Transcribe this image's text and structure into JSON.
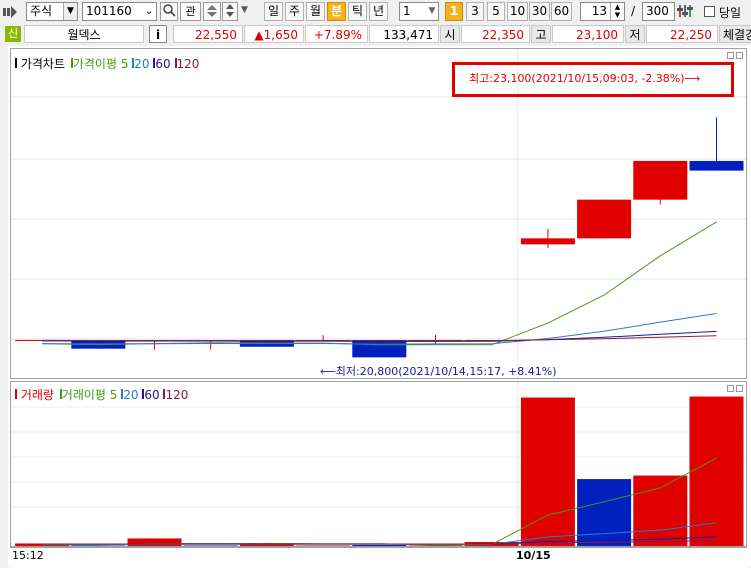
{
  "toolbar": {
    "market": "주식",
    "code": "101160",
    "btn_interest": "관",
    "periods": [
      "일",
      "주",
      "월",
      "분",
      "틱",
      "년"
    ],
    "active_period": "분",
    "unit_value": "1",
    "intervals": [
      "1",
      "3",
      "5",
      "10",
      "30",
      "60"
    ],
    "active_interval": "1",
    "count_value": "13",
    "slash": "/",
    "total_value": "300",
    "today_label": "당일"
  },
  "quote": {
    "badge": "신",
    "name": "월덱스",
    "info": "i",
    "price": "22,550",
    "change": "▲1,650",
    "change_pct": "+7.89%",
    "volume": "133,471",
    "open_label": "시",
    "open": "22,350",
    "high_label": "고",
    "high": "23,100",
    "low_label": "저",
    "low": "22,250",
    "exec_label": "체결강"
  },
  "price_panel": {
    "legend": {
      "main": "가격차트",
      "ma_label": "가격이평",
      "ma": [
        "5",
        "20",
        "60",
        "120"
      ]
    },
    "high_annotation": "최고:23,100(2021/10/15,09:03, -2.38%)⟶",
    "low_annotation": "⟵최저:20,800(2021/10/14,15:17, +8.41%)"
  },
  "volume_panel": {
    "legend": {
      "main": "거래량",
      "ma_label": "거래이평",
      "ma": [
        "5",
        "20",
        "60",
        "120"
      ]
    }
  },
  "x_axis": {
    "left_label": "15:12",
    "right_label": "10/15"
  },
  "colors": {
    "up": "#e00000",
    "down": "#0020c0",
    "ma5": "#4a9a10",
    "ma20": "#2a7acc",
    "ma60": "#1a1a9a",
    "ma120": "#8a1a4a",
    "active": "#f6b21a",
    "highlight_box": "#e00000"
  },
  "chart_data": {
    "type": "candlestick",
    "candles": [
      {
        "o": 20800,
        "h": 20800,
        "l": 20800,
        "c": 20800,
        "dir": "flat"
      },
      {
        "o": 20800,
        "h": 20800,
        "l": 20710,
        "c": 20710,
        "dir": "down"
      },
      {
        "o": 20800,
        "h": 20800,
        "l": 20700,
        "c": 20800,
        "dir": "flat"
      },
      {
        "o": 20800,
        "h": 20800,
        "l": 20700,
        "c": 20800,
        "dir": "flat"
      },
      {
        "o": 20800,
        "h": 20800,
        "l": 20730,
        "c": 20730,
        "dir": "down"
      },
      {
        "o": 20800,
        "h": 20850,
        "l": 20800,
        "c": 20800,
        "dir": "flat"
      },
      {
        "o": 20800,
        "h": 20800,
        "l": 20620,
        "c": 20620,
        "dir": "down"
      },
      {
        "o": 20800,
        "h": 20850,
        "l": 20750,
        "c": 20800,
        "dir": "flat"
      },
      {
        "o": 20800,
        "h": 20800,
        "l": 20800,
        "c": 20800,
        "dir": "flat"
      },
      {
        "o": 21850,
        "h": 21950,
        "l": 21750,
        "c": 21850,
        "dir": "up"
      },
      {
        "o": 21850,
        "h": 22250,
        "l": 21850,
        "c": 22250,
        "dir": "up"
      },
      {
        "o": 22250,
        "h": 22650,
        "l": 22200,
        "c": 22650,
        "dir": "up"
      },
      {
        "o": 22650,
        "h": 23100,
        "l": 22650,
        "c": 22550,
        "dir": "down"
      }
    ],
    "volume": [
      5,
      1,
      15,
      1,
      4,
      1,
      2,
      1,
      8,
      295,
      133,
      140,
      297
    ],
    "volume_dir": [
      "up",
      "down",
      "up",
      "down",
      "up",
      "up",
      "down",
      "up",
      "up",
      "up",
      "down",
      "up",
      "up"
    ]
  }
}
